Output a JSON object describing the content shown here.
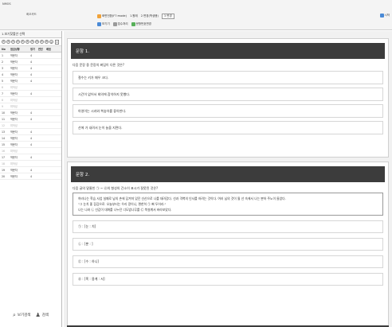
{
  "app": {
    "title": "NMOS"
  },
  "user": {
    "label": "희오카드"
  },
  "toolbar": {
    "row1": [
      {
        "label": "화면전환(F7:mode)",
        "icon": "orange"
      },
      {
        "label": "1.원래"
      },
      {
        "label": "2.변경(학생용)"
      },
      {
        "label": "3.변경",
        "boxed": true
      }
    ],
    "row2": [
      {
        "label": "보기기",
        "icon": "blue"
      },
      {
        "label": "접수처리",
        "icon": "gray"
      },
      {
        "label": "문항번호변경",
        "icon": "green"
      }
    ],
    "right_label": "시작"
  },
  "sidebar": {
    "header": "1.보기찾틀안 선택",
    "filter_marks": [
      "①",
      "②",
      "③",
      "④",
      "⑤",
      "⑥",
      "⑦",
      "⑧",
      "⑨",
      "⑩",
      "⑪"
    ],
    "columns": {
      "no": "No",
      "status": "점검상황",
      "a": "정가",
      "b": "판단",
      "c": "배점"
    },
    "rows": [
      {
        "no": "1",
        "status": "작문자",
        "a": "4",
        "pending": false
      },
      {
        "no": "2",
        "status": "작문자",
        "a": "4",
        "pending": false
      },
      {
        "no": "3",
        "status": "작문자",
        "a": "4",
        "pending": false
      },
      {
        "no": "4",
        "status": "작문자",
        "a": "4",
        "pending": false
      },
      {
        "no": "5",
        "status": "작문자",
        "a": "4",
        "pending": false
      },
      {
        "no": "6",
        "status": "미작성",
        "a": "",
        "pending": true
      },
      {
        "no": "7",
        "status": "작문자",
        "a": "4",
        "pending": false
      },
      {
        "no": "8",
        "status": "미작성",
        "a": "",
        "pending": true
      },
      {
        "no": "9",
        "status": "미작성",
        "a": "",
        "pending": true
      },
      {
        "no": "10",
        "status": "작문자",
        "a": "4",
        "pending": false
      },
      {
        "no": "11",
        "status": "작문자",
        "a": "4",
        "pending": false
      },
      {
        "no": "12",
        "status": "미작성",
        "a": "",
        "pending": true
      },
      {
        "no": "13",
        "status": "작문자",
        "a": "4",
        "pending": false
      },
      {
        "no": "14",
        "status": "작문자",
        "a": "4",
        "pending": false
      },
      {
        "no": "15",
        "status": "작문자",
        "a": "4",
        "pending": false
      },
      {
        "no": "16",
        "status": "미작성",
        "a": "",
        "pending": true
      },
      {
        "no": "17",
        "status": "작문자",
        "a": "4",
        "pending": false
      },
      {
        "no": "18",
        "status": "미작성",
        "a": "",
        "pending": true
      },
      {
        "no": "19",
        "status": "작문자",
        "a": "4",
        "pending": false
      },
      {
        "no": "20",
        "status": "작문자",
        "a": "4",
        "pending": false
      }
    ],
    "footer": {
      "search_label": "보기검색",
      "user_label": "검색"
    }
  },
  "questions": [
    {
      "title": "문항 1.",
      "stem": "다음 문장 중 문장의 짜임이 다른 것은?",
      "options": [
        "철수는 키가 매우 크다.",
        "시간이 없어서 회의에 참석하지 못했다.",
        "아영이는 시과와 복숭아를 좋아한다.",
        "산에 가 내려서 눈이 늘을 지면다."
      ]
    },
    {
      "title": "문항 2.",
      "stem": "다음 글의 밑줄친 ㉠ ~ ㉣의 형성의 간소이 표시가 잘못된 것은?",
      "passage": [
        "여러나는 학습 사업 실패로 남의 손에 담겨져 있던 선산으로 나를 데려갔다. 선과 격벽의 인사를 하려는 것이다. 여러 님의 것이 될 선 속에서 나는 뿐하 주노이 들었다.",
        "\"그 눈치 좋 장감으로. 오늘부터는 우리 땅이니, 편한히 ㉠ 뻐 두어라.\"",
        "나는 나와 ㉡ 선감이 대화를 나누던 너도밤나무를 ㉢ 북설계서 바라보았다."
      ],
      "options": [
        "㉠ : [눈 : 치]",
        "㉡ : [뿐 : ]",
        "㉢ : [수 : 하니]",
        "㉣ : [혹 : 용계 : 서]"
      ]
    }
  ]
}
